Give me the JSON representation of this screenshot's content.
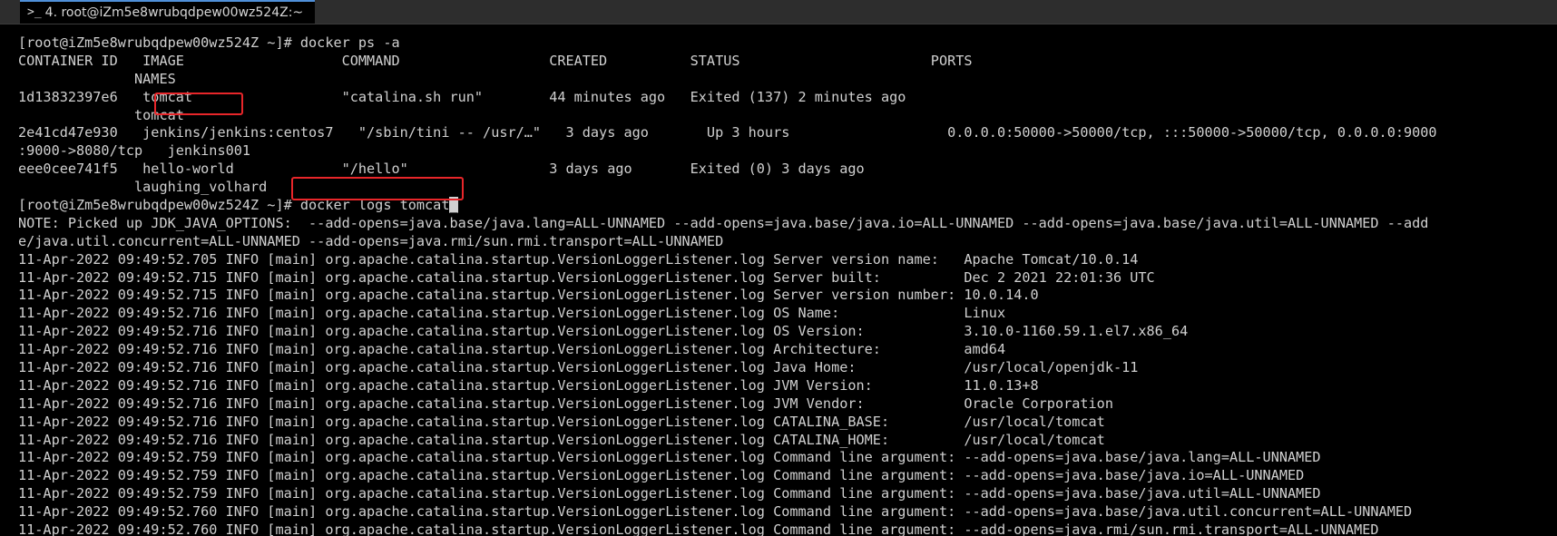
{
  "window": {
    "tab_icon": ">_",
    "tab_title": "4. root@iZm5e8wrubqdpew00wz524Z:~"
  },
  "terminal": {
    "lines": [
      "[root@iZm5e8wrubqdpew00wz524Z ~]# docker ps -a",
      "CONTAINER ID   IMAGE                   COMMAND                  CREATED          STATUS                       PORTS",
      "              NAMES",
      "1d13832397e6   tomcat                  \"catalina.sh run\"        44 minutes ago   Exited (137) 2 minutes ago",
      "              tomcat",
      "2e41cd47e930   jenkins/jenkins:centos7   \"/sbin/tini -- /usr/…\"   3 days ago       Up 3 hours                   0.0.0.0:50000->50000/tcp, :::50000->50000/tcp, 0.0.0.0:9000",
      ":9000->8080/tcp   jenkins001",
      "eee0cee741f5   hello-world             \"/hello\"                 3 days ago       Exited (0) 3 days ago",
      "              laughing_volhard",
      "[root@iZm5e8wrubqdpew00wz524Z ~]# docker logs tomcat",
      "NOTE: Picked up JDK_JAVA_OPTIONS:  --add-opens=java.base/java.lang=ALL-UNNAMED --add-opens=java.base/java.io=ALL-UNNAMED --add-opens=java.base/java.util=ALL-UNNAMED --add",
      "e/java.util.concurrent=ALL-UNNAMED --add-opens=java.rmi/sun.rmi.transport=ALL-UNNAMED",
      "11-Apr-2022 09:49:52.705 INFO [main] org.apache.catalina.startup.VersionLoggerListener.log Server version name:   Apache Tomcat/10.0.14",
      "11-Apr-2022 09:49:52.715 INFO [main] org.apache.catalina.startup.VersionLoggerListener.log Server built:          Dec 2 2021 22:01:36 UTC",
      "11-Apr-2022 09:49:52.715 INFO [main] org.apache.catalina.startup.VersionLoggerListener.log Server version number: 10.0.14.0",
      "11-Apr-2022 09:49:52.716 INFO [main] org.apache.catalina.startup.VersionLoggerListener.log OS Name:               Linux",
      "11-Apr-2022 09:49:52.716 INFO [main] org.apache.catalina.startup.VersionLoggerListener.log OS Version:            3.10.0-1160.59.1.el7.x86_64",
      "11-Apr-2022 09:49:52.716 INFO [main] org.apache.catalina.startup.VersionLoggerListener.log Architecture:          amd64",
      "11-Apr-2022 09:49:52.716 INFO [main] org.apache.catalina.startup.VersionLoggerListener.log Java Home:             /usr/local/openjdk-11",
      "11-Apr-2022 09:49:52.716 INFO [main] org.apache.catalina.startup.VersionLoggerListener.log JVM Version:           11.0.13+8",
      "11-Apr-2022 09:49:52.716 INFO [main] org.apache.catalina.startup.VersionLoggerListener.log JVM Vendor:            Oracle Corporation",
      "11-Apr-2022 09:49:52.716 INFO [main] org.apache.catalina.startup.VersionLoggerListener.log CATALINA_BASE:         /usr/local/tomcat",
      "11-Apr-2022 09:49:52.716 INFO [main] org.apache.catalina.startup.VersionLoggerListener.log CATALINA_HOME:         /usr/local/tomcat",
      "11-Apr-2022 09:49:52.759 INFO [main] org.apache.catalina.startup.VersionLoggerListener.log Command line argument: --add-opens=java.base/java.lang=ALL-UNNAMED",
      "11-Apr-2022 09:49:52.759 INFO [main] org.apache.catalina.startup.VersionLoggerListener.log Command line argument: --add-opens=java.base/java.io=ALL-UNNAMED",
      "11-Apr-2022 09:49:52.759 INFO [main] org.apache.catalina.startup.VersionLoggerListener.log Command line argument: --add-opens=java.base/java.util=ALL-UNNAMED",
      "11-Apr-2022 09:49:52.760 INFO [main] org.apache.catalina.startup.VersionLoggerListener.log Command line argument: --add-opens=java.base/java.util.concurrent=ALL-UNNAMED",
      "11-Apr-2022 09:49:52.760 INFO [main] org.apache.catalina.startup.VersionLoggerListener.log Command line argument: --add-opens=java.rmi/sun.rmi.transport=ALL-UNNAMED"
    ],
    "cursor_char": "_"
  },
  "colors": {
    "background": "#000000",
    "text": "#d0d0d0",
    "highlight": "#e8262a",
    "tab_accent": "#4f8fd8"
  }
}
